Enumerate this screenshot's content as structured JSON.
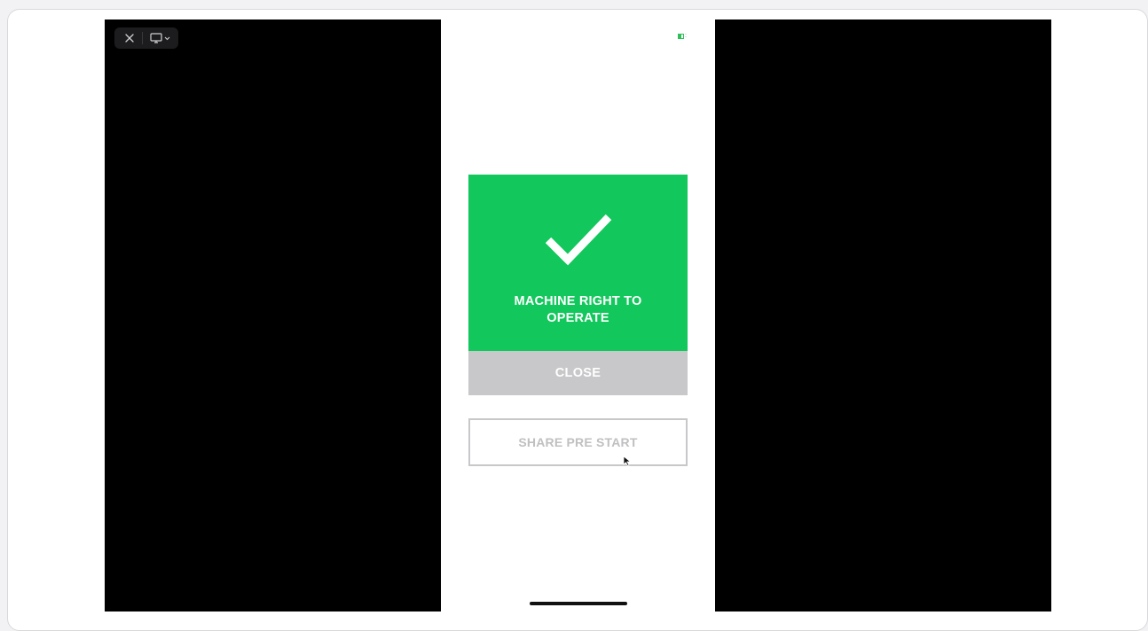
{
  "window": {
    "toolbar": {
      "close_icon": "close-icon",
      "display_icon": "display-icon",
      "chevron_icon": "chevron-down-icon"
    }
  },
  "status_bar": {
    "battery_icon": "battery-icon",
    "battery_color": "#2fbf5a"
  },
  "result": {
    "icon": "checkmark-icon",
    "message": "MACHINE RIGHT TO OPERATE",
    "color": "#12c75c"
  },
  "actions": {
    "close_label": "CLOSE",
    "share_label": "SHARE PRE START"
  }
}
